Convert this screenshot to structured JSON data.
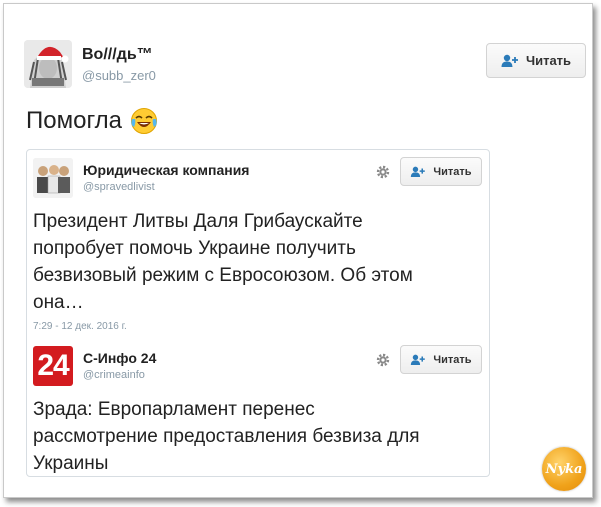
{
  "main_tweet": {
    "user_name": "Во///дь™",
    "user_handle": "@subb_zer0",
    "follow_label": "Читать",
    "text": "Помогла"
  },
  "quoted_1": {
    "user_name": "Юридическая компания",
    "user_handle": "@spravedlivist",
    "follow_label": "Читать",
    "text_lines": [
      "Президент Литвы Даля Грибаускайте",
      "попробует помочь Украине получить",
      "безвизовый режим с Евросоюзом. Об этом",
      "она…"
    ],
    "timestamp": "7:29 - 12 дек. 2016 г."
  },
  "quoted_2": {
    "user_name": "С-Инфо 24",
    "user_handle": "@crimeainfo",
    "avatar_text": "24",
    "follow_label": "Читать",
    "text_lines": [
      "Зрада: Европарламент перенес",
      "рассмотрение предоставления безвиза для",
      "Украины"
    ]
  },
  "watermark": {
    "text": "Nyka"
  },
  "colors": {
    "text": "#222222",
    "handle": "#8899a6",
    "follow_icon": "#2b7bb9",
    "c_info_red": "#d31b1f",
    "watermark_orange": "#f0a21a"
  },
  "icons": {
    "emoji": "face-with-tears-of-joy-icon",
    "follow": "add-user-icon",
    "settings": "gear-icon"
  }
}
